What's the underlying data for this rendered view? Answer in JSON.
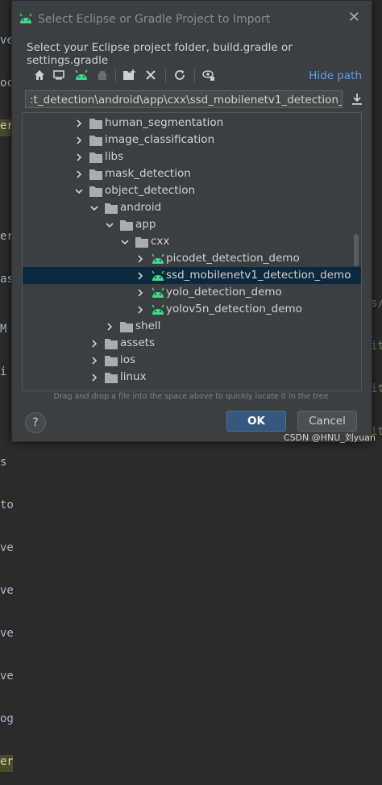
{
  "dialog": {
    "title": "Select Eclipse or Gradle Project to Import",
    "subtitle": "Select your Eclipse project folder, build.gradle or settings.gradle",
    "hide_path_label": "Hide path",
    "path_value": ":t_detection\\android\\app\\cxx\\ssd_mobilenetv1_detection_demo",
    "hint": "Drag and drop a file into the space above to quickly locate it in the tree",
    "help_label": "?",
    "ok_label": "OK",
    "cancel_label": "Cancel"
  },
  "toolbar": {
    "icons": [
      "home-icon",
      "desktop-icon",
      "android-icon",
      "module-icon",
      "new-folder-icon",
      "delete-icon",
      "refresh-icon",
      "show-hidden-icon"
    ]
  },
  "tree": {
    "items": [
      {
        "label": "human_segmentation",
        "depth": 0,
        "expanded": false,
        "type": "folder"
      },
      {
        "label": "image_classification",
        "depth": 0,
        "expanded": false,
        "type": "folder"
      },
      {
        "label": "libs",
        "depth": 0,
        "expanded": false,
        "type": "folder"
      },
      {
        "label": "mask_detection",
        "depth": 0,
        "expanded": false,
        "type": "folder"
      },
      {
        "label": "object_detection",
        "depth": 0,
        "expanded": true,
        "type": "folder"
      },
      {
        "label": "android",
        "depth": 1,
        "expanded": true,
        "type": "folder"
      },
      {
        "label": "app",
        "depth": 2,
        "expanded": true,
        "type": "folder"
      },
      {
        "label": "cxx",
        "depth": 3,
        "expanded": true,
        "type": "folder"
      },
      {
        "label": "picodet_detection_demo",
        "depth": 4,
        "expanded": false,
        "type": "android"
      },
      {
        "label": "ssd_mobilenetv1_detection_demo",
        "depth": 4,
        "expanded": false,
        "type": "android",
        "selected": true
      },
      {
        "label": "yolo_detection_demo",
        "depth": 4,
        "expanded": false,
        "type": "android"
      },
      {
        "label": "yolov5n_detection_demo",
        "depth": 4,
        "expanded": false,
        "type": "android"
      },
      {
        "label": "shell",
        "depth": 2,
        "expanded": false,
        "type": "folder"
      },
      {
        "label": "assets",
        "depth": 1,
        "expanded": false,
        "type": "folder"
      },
      {
        "label": "ios",
        "depth": 1,
        "expanded": false,
        "type": "folder"
      },
      {
        "label": "linux",
        "depth": 1,
        "expanded": false,
        "type": "folder"
      }
    ]
  },
  "background": {
    "left_fragments": [
      "ve",
      "oc",
      "er",
      "",
      "",
      "er",
      "as",
      "",
      "M",
      "i",
      "",
      "",
      "",
      "s",
      "to",
      "ve",
      "ve",
      "ve",
      "ve",
      "og",
      "er"
    ],
    "right_fragments": [
      "",
      "",
      "",
      "",
      "",
      "",
      "",
      "",
      "",
      "",
      "",
      "",
      "",
      "",
      "",
      "s/",
      "it",
      "it",
      "it",
      "",
      ""
    ]
  },
  "watermark": "CSDN @HNU_刘yuan",
  "colors": {
    "accent": "#589df6",
    "selection": "#0d293e",
    "android_green": "#3ddc84",
    "folder": "#a9adb2"
  }
}
